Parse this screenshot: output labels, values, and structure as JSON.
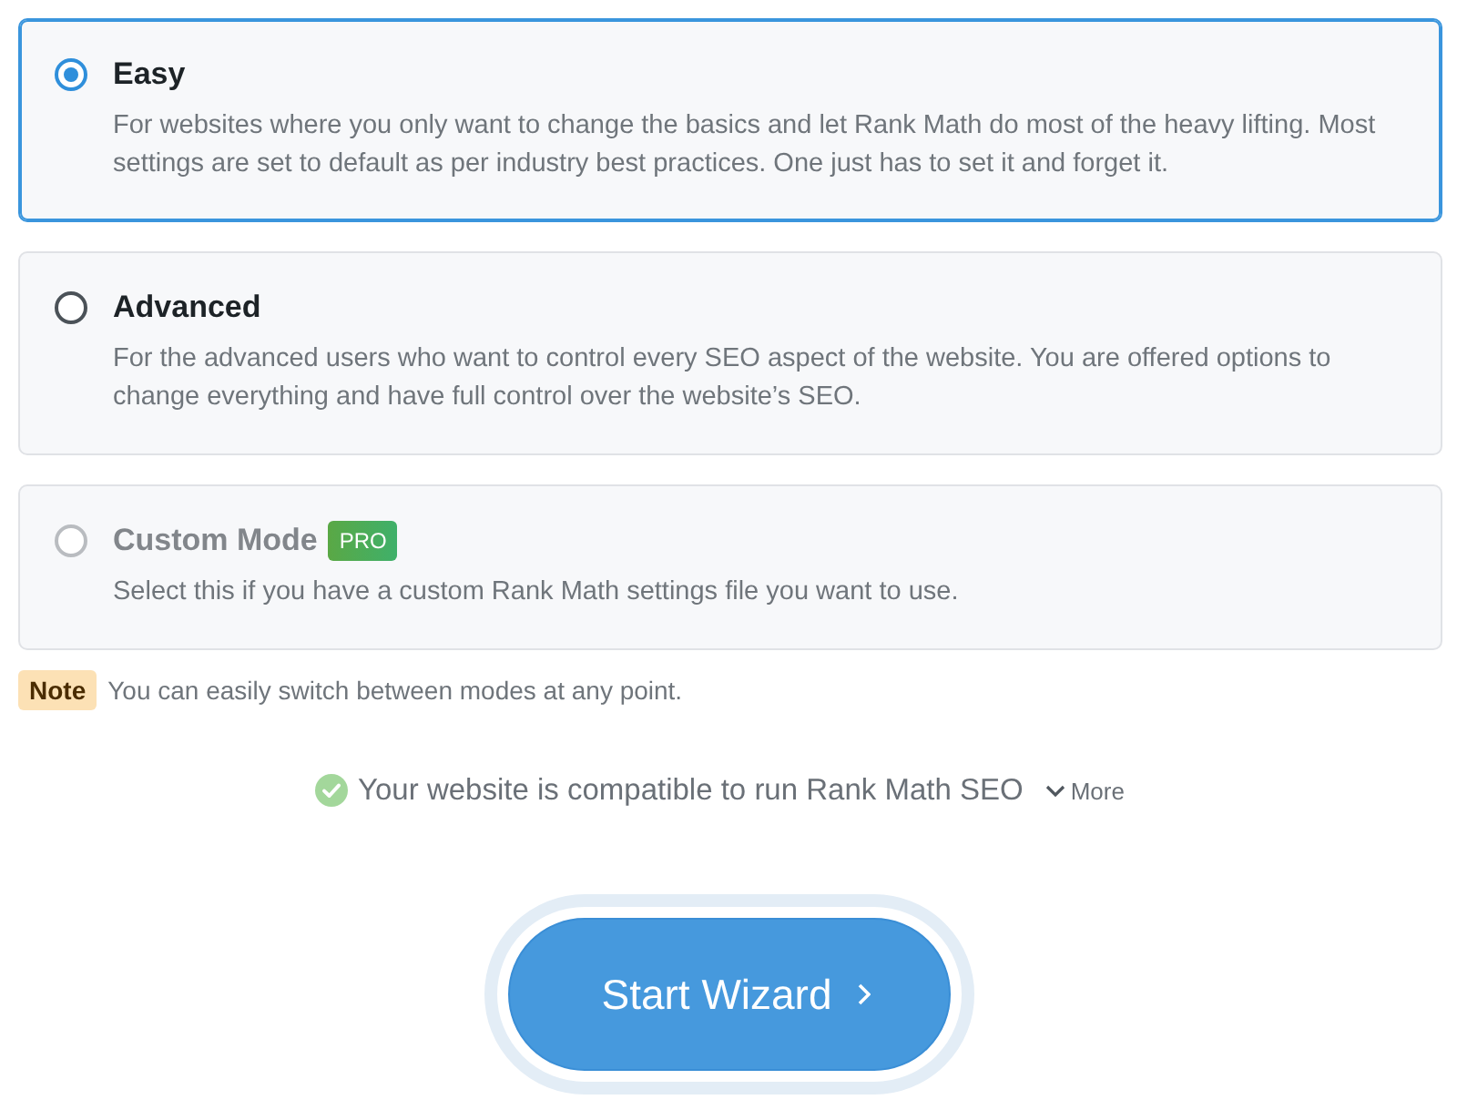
{
  "modes": [
    {
      "title": "Easy",
      "description": "For websites where you only want to change the basics and let Rank Math do most of the heavy lifting. Most settings are set to default as per industry best practices. One just has to set it and forget it.",
      "selected": true,
      "disabled": false
    },
    {
      "title": "Advanced",
      "description": "For the advanced users who want to control every SEO aspect of the website. You are offered options to change everything and have full control over the website’s SEO.",
      "selected": false,
      "disabled": false
    },
    {
      "title": "Custom Mode",
      "badge": "PRO",
      "description": "Select this if you have a custom Rank Math settings file you want to use.",
      "selected": false,
      "disabled": true
    }
  ],
  "note": {
    "label": "Note",
    "text": "You can easily switch between modes at any point."
  },
  "compatibility": {
    "compatible": true,
    "text": "Your website is compatible to run Rank Math SEO",
    "more_link": "More"
  },
  "start_button": {
    "label": "Start Wizard"
  }
}
